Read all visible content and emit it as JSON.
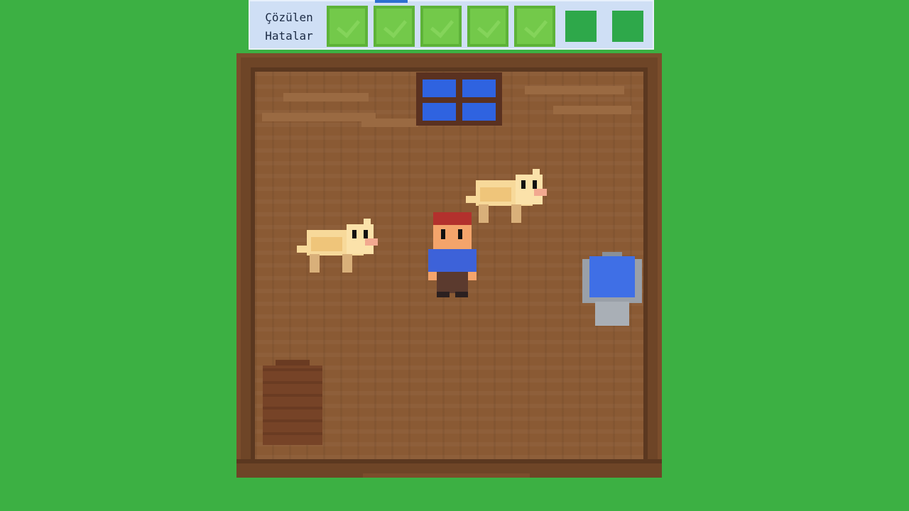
{
  "hud": {
    "label_line1": "Çözülen",
    "label_line2": "Hatalar",
    "slots": [
      {
        "state": "solved"
      },
      {
        "state": "solved"
      },
      {
        "state": "solved"
      },
      {
        "state": "solved"
      },
      {
        "state": "solved"
      },
      {
        "state": "unsolved"
      },
      {
        "state": "unsolved"
      }
    ],
    "solved_count": 5,
    "total_count": 7
  },
  "scene": {
    "room": "barn-interior",
    "entities": [
      "cow",
      "cow",
      "farmer",
      "water-bucket",
      "window",
      "stairs"
    ]
  },
  "colors": {
    "background": "#3cb043",
    "floor": "#8a5a34",
    "hud_bg": "#cfdff5",
    "solved_slot": "#73c94a",
    "unsolved_slot": "#2ea84a"
  }
}
